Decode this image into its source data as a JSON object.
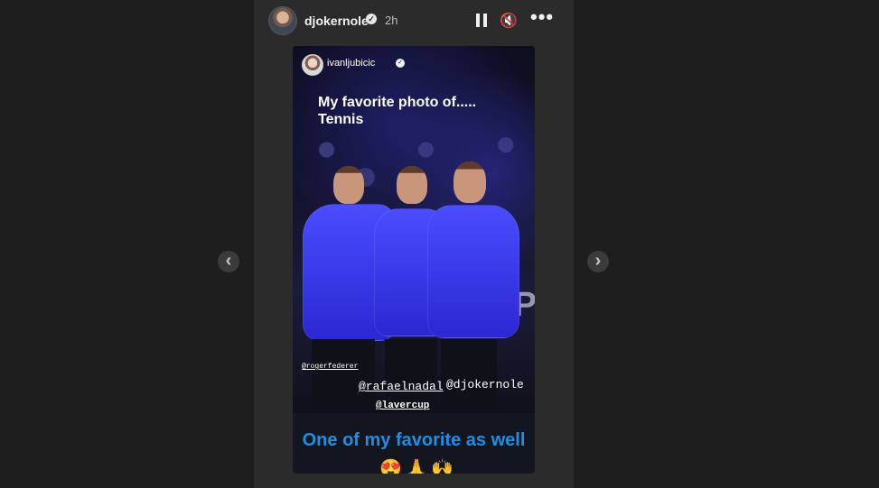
{
  "header": {
    "username": "djokernole",
    "time": "2h"
  },
  "story_post": {
    "account": "ivanljubicic",
    "caption": "My favorite photo of.....\nTennis",
    "scene_text": "CUP",
    "tags": {
      "tag1": "@rogerfederer",
      "tag2": "@rafaelnadal",
      "tag3": "@djokernole",
      "tag4": "@lavercup"
    }
  },
  "reply": {
    "text": "One of my favorite as well",
    "emojis": [
      "😍",
      "🙏",
      "🙌"
    ]
  },
  "icons": {
    "verified": "✓",
    "left_arrow": "‹",
    "right_arrow": "›",
    "mute": "🔇",
    "more": "•••"
  }
}
